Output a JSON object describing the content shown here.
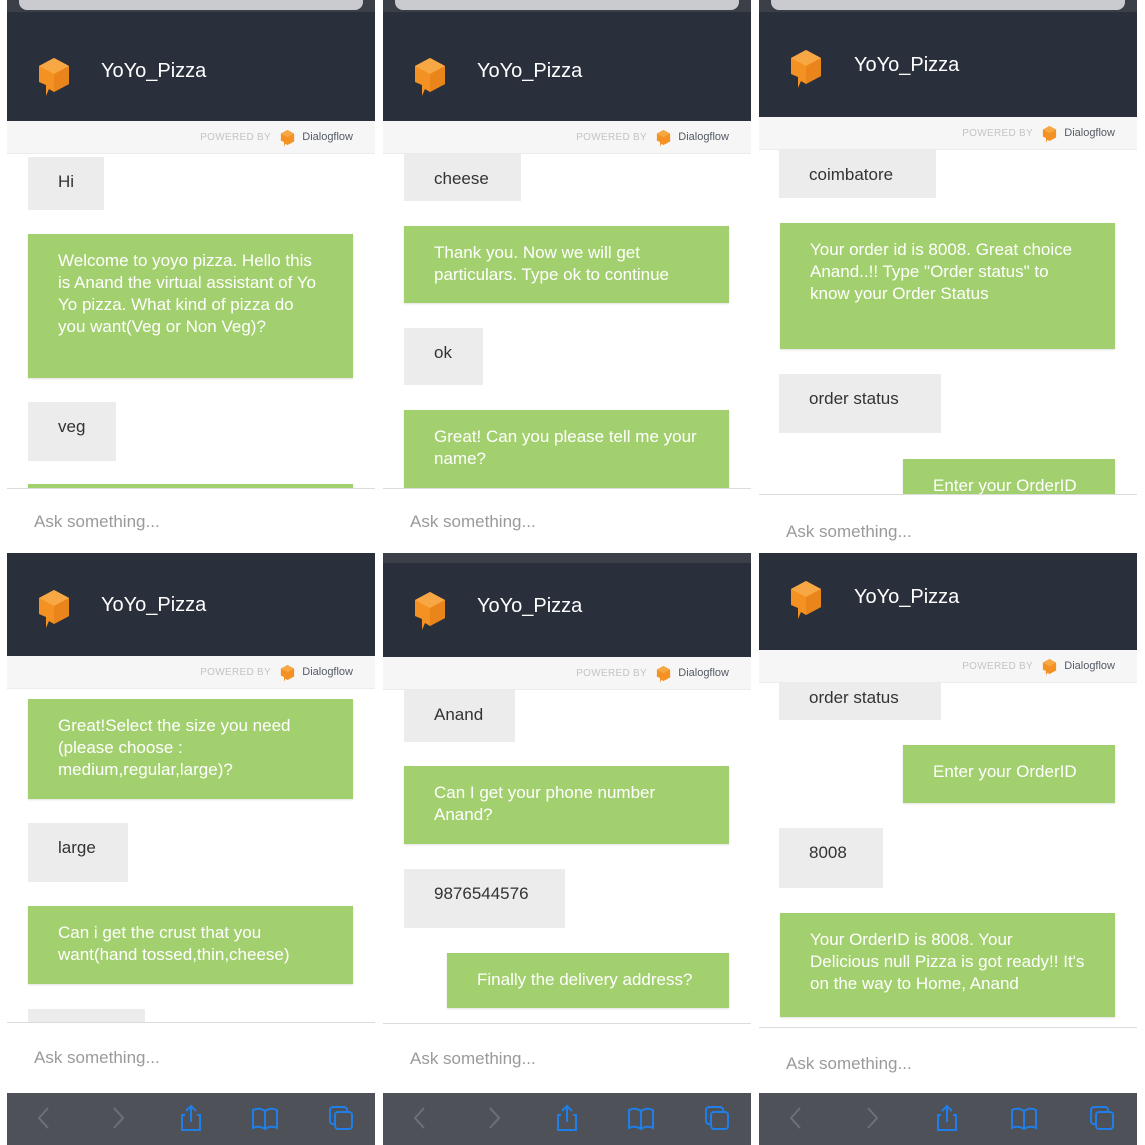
{
  "app": {
    "title": "YoYo_Pizza",
    "powered_by": "POWERED BY",
    "brand": "Dialogflow",
    "input_placeholder": "Ask something..."
  },
  "colors": {
    "header": "#2a303b",
    "bot_bubble": "#a3d06f",
    "user_bubble": "#ececec",
    "logo": "#f39222",
    "toolbar_icon": "#1f7ee8"
  },
  "icons": {
    "header_logo": "dialogflow-logo-icon",
    "toolbar": [
      "back-icon",
      "forward-icon",
      "share-icon",
      "bookmarks-icon",
      "tabs-icon"
    ]
  },
  "screens": [
    {
      "messages": [
        {
          "from": "user",
          "text": "Hi"
        },
        {
          "from": "bot",
          "text": "Welcome to yoyo pizza. Hello this is Anand the virtual assistant of Yo Yo pizza. What kind of pizza do you want(Veg or Non Veg)?"
        },
        {
          "from": "user",
          "text": "veg"
        }
      ]
    },
    {
      "messages": [
        {
          "from": "user",
          "text": "cheese"
        },
        {
          "from": "bot",
          "text": "Thank you. Now we will get particulars. Type ok to continue"
        },
        {
          "from": "user",
          "text": "ok"
        },
        {
          "from": "bot",
          "text": "Great! Can you please tell me your name?"
        }
      ]
    },
    {
      "messages": [
        {
          "from": "user",
          "text": "coimbatore"
        },
        {
          "from": "bot",
          "text": "Your order id is 8008. Great choice Anand..!! Type \"Order status\" to know your Order Status"
        },
        {
          "from": "user",
          "text": "order status"
        },
        {
          "from": "bot",
          "text": "Enter your OrderID"
        }
      ]
    },
    {
      "messages": [
        {
          "from": "bot",
          "text": "Great!Select the size you need (please choose : medium,regular,large)?"
        },
        {
          "from": "user",
          "text": "large"
        },
        {
          "from": "bot",
          "text": "Can i get the crust that you want(hand tossed,thin,cheese)"
        }
      ]
    },
    {
      "messages": [
        {
          "from": "user",
          "text": "Anand"
        },
        {
          "from": "bot",
          "text": "Can I get your phone number Anand?"
        },
        {
          "from": "user",
          "text": "9876544576"
        },
        {
          "from": "bot",
          "text": "Finally the delivery address?"
        }
      ]
    },
    {
      "messages": [
        {
          "from": "user",
          "text": "order status"
        },
        {
          "from": "bot",
          "text": "Enter your OrderID"
        },
        {
          "from": "user",
          "text": "8008"
        },
        {
          "from": "bot",
          "text": "Your OrderID is 8008. Your Delicious null Pizza is got ready!! It's on the way to Home, Anand"
        }
      ]
    }
  ]
}
